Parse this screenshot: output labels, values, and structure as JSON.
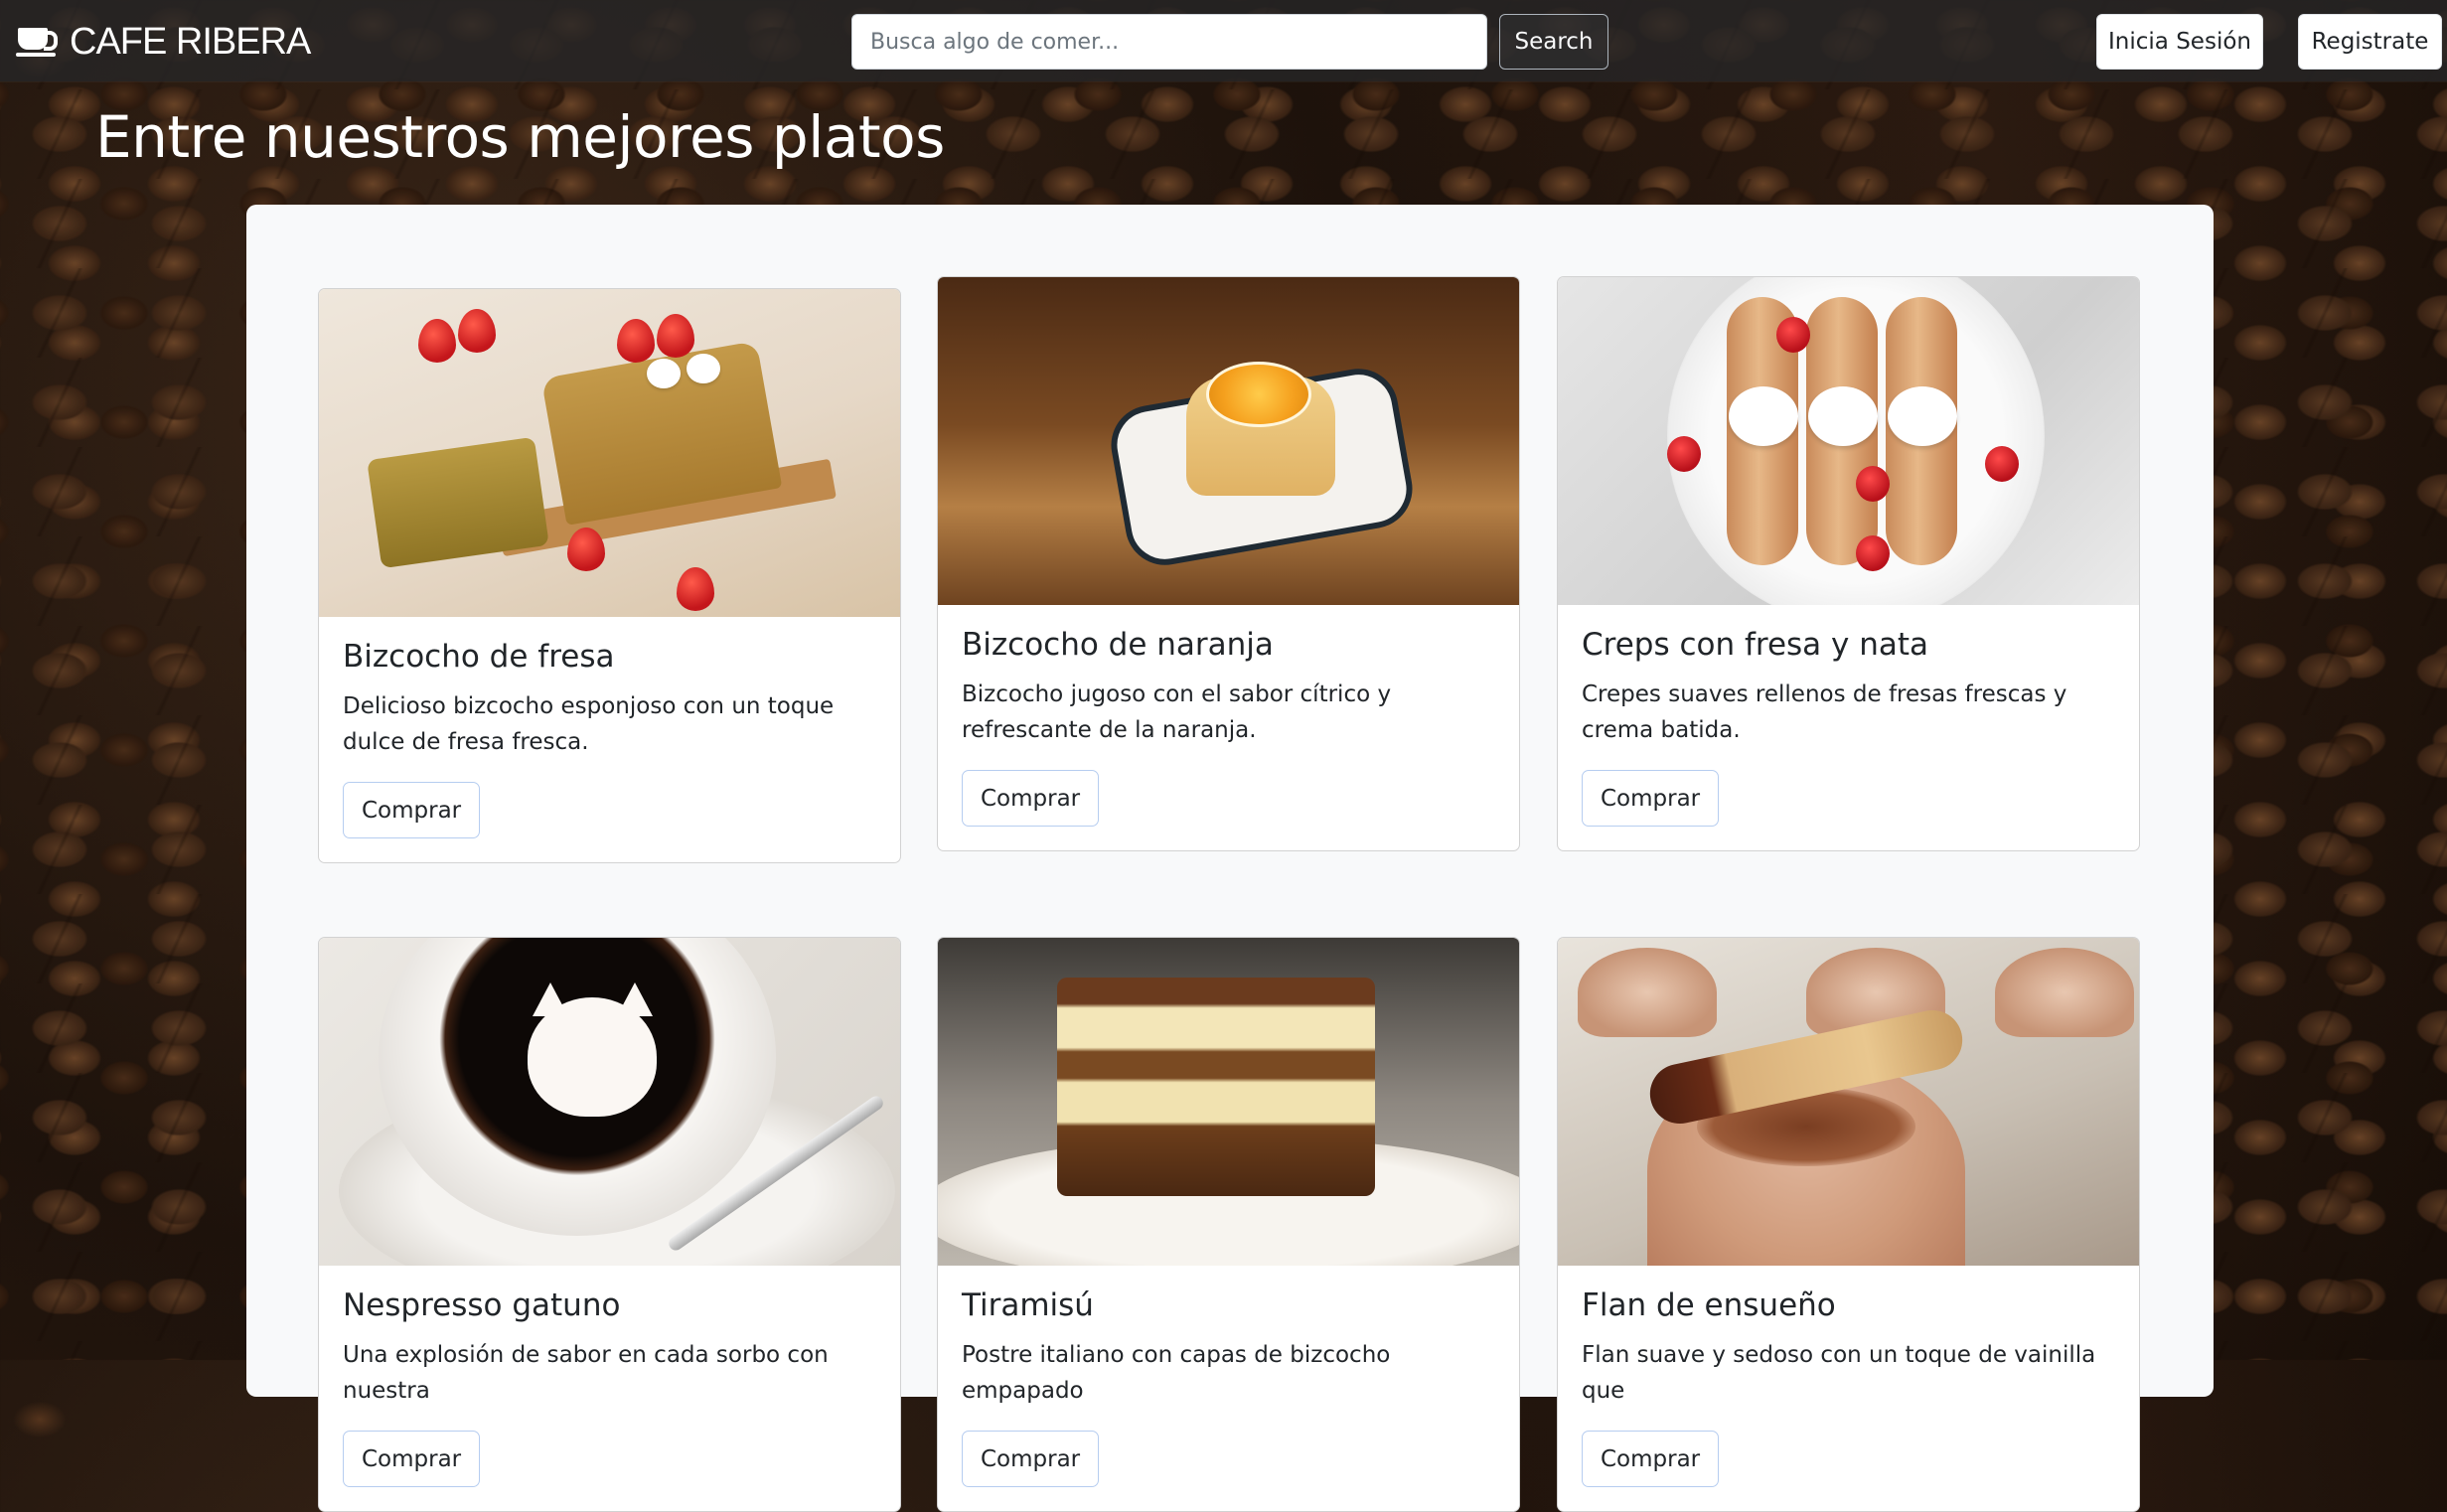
{
  "brand": {
    "name": "CAFE RIBERA"
  },
  "search": {
    "placeholder": "Busca algo de comer...",
    "value": "",
    "button_label": "Search"
  },
  "auth": {
    "login_label": "Inicia Sesión",
    "register_label": "Registrate"
  },
  "page": {
    "title": "Entre nuestros mejores platos"
  },
  "products": [
    {
      "title": "Bizcocho de fresa",
      "description": "Delicioso bizcocho esponjoso con un toque dulce de fresa fresca.",
      "button": "Comprar"
    },
    {
      "title": "Bizcocho de naranja",
      "description": "Bizcocho jugoso con el sabor cítrico y refrescante de la naranja.",
      "button": "Comprar"
    },
    {
      "title": "Creps con fresa y nata",
      "description": "Crepes suaves rellenos de fresas frescas y crema batida.",
      "button": "Comprar"
    },
    {
      "title": "Nespresso gatuno",
      "description": "Una explosión de sabor en cada sorbo con nuestra",
      "button": "Comprar"
    },
    {
      "title": "Tiramisú",
      "description": "Postre italiano con capas de bizcocho empapado",
      "button": "Comprar"
    },
    {
      "title": "Flan de ensueño",
      "description": "Flan suave y sedoso con un toque de vainilla que",
      "button": "Comprar"
    }
  ],
  "colors": {
    "navbar_bg": "#262628",
    "panel_bg": "#f8f9fa",
    "button_outline": "#b6cdf0",
    "text": "#212529"
  }
}
